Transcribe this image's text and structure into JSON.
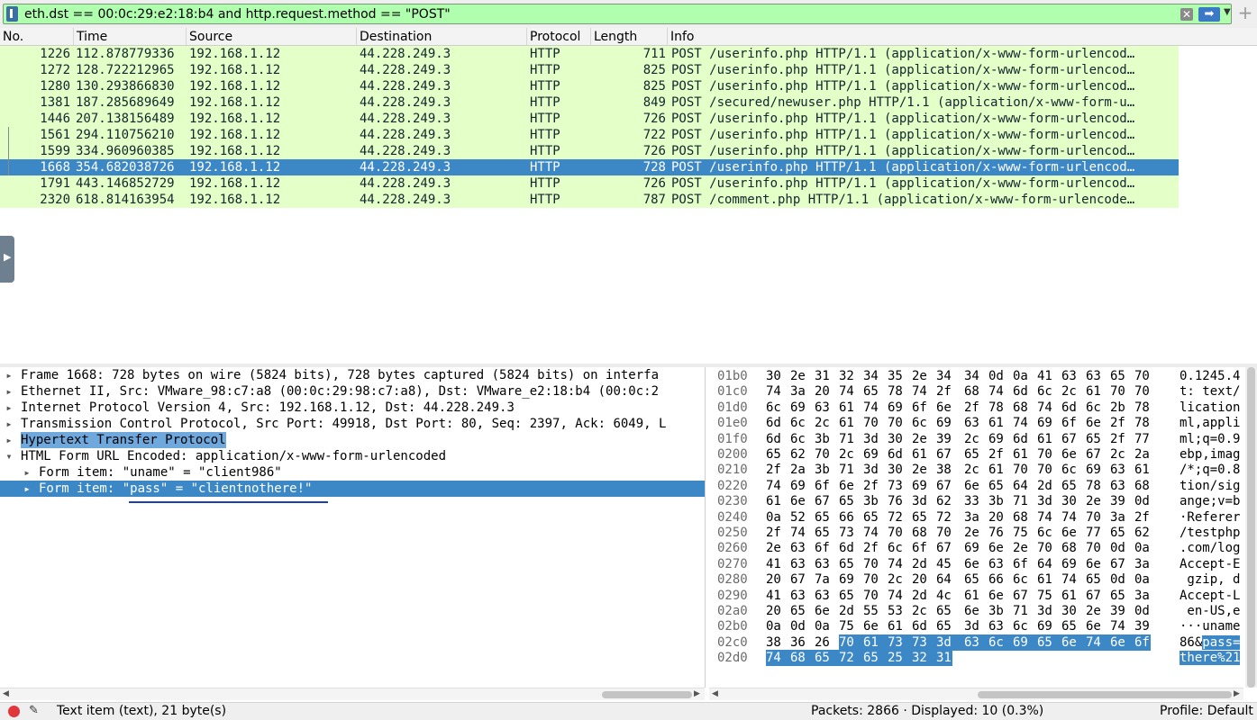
{
  "filter": {
    "value": "eth.dst == 00:0c:29:e2:18:b4 and http.request.method == \"POST\"",
    "clear_glyph": "✕",
    "apply_glyph": "➡",
    "dropdown_glyph": "▼",
    "add_glyph": "+"
  },
  "packet_list": {
    "columns": [
      "No.",
      "Time",
      "Source",
      "Destination",
      "Protocol",
      "Length",
      "Info"
    ],
    "rows": [
      {
        "no": "1226",
        "time": "112.878779336",
        "src": "192.168.1.12",
        "dst": "44.228.249.3",
        "proto": "HTTP",
        "len": "711",
        "info": "POST /userinfo.php HTTP/1.1  (application/x-www-form-urlencod…"
      },
      {
        "no": "1272",
        "time": "128.722212965",
        "src": "192.168.1.12",
        "dst": "44.228.249.3",
        "proto": "HTTP",
        "len": "825",
        "info": "POST /userinfo.php HTTP/1.1  (application/x-www-form-urlencod…"
      },
      {
        "no": "1280",
        "time": "130.293866830",
        "src": "192.168.1.12",
        "dst": "44.228.249.3",
        "proto": "HTTP",
        "len": "825",
        "info": "POST /userinfo.php HTTP/1.1  (application/x-www-form-urlencod…"
      },
      {
        "no": "1381",
        "time": "187.285689649",
        "src": "192.168.1.12",
        "dst": "44.228.249.3",
        "proto": "HTTP",
        "len": "849",
        "info": "POST /secured/newuser.php HTTP/1.1  (application/x-www-form-u…"
      },
      {
        "no": "1446",
        "time": "207.138156489",
        "src": "192.168.1.12",
        "dst": "44.228.249.3",
        "proto": "HTTP",
        "len": "726",
        "info": "POST /userinfo.php HTTP/1.1  (application/x-www-form-urlencod…"
      },
      {
        "no": "1561",
        "time": "294.110756210",
        "src": "192.168.1.12",
        "dst": "44.228.249.3",
        "proto": "HTTP",
        "len": "722",
        "info": "POST /userinfo.php HTTP/1.1  (application/x-www-form-urlencod…"
      },
      {
        "no": "1599",
        "time": "334.960960385",
        "src": "192.168.1.12",
        "dst": "44.228.249.3",
        "proto": "HTTP",
        "len": "726",
        "info": "POST /userinfo.php HTTP/1.1  (application/x-www-form-urlencod…"
      },
      {
        "no": "1668",
        "time": "354.682038726",
        "src": "192.168.1.12",
        "dst": "44.228.249.3",
        "proto": "HTTP",
        "len": "728",
        "info": "POST /userinfo.php HTTP/1.1  (application/x-www-form-urlencod…"
      },
      {
        "no": "1791",
        "time": "443.146852729",
        "src": "192.168.1.12",
        "dst": "44.228.249.3",
        "proto": "HTTP",
        "len": "726",
        "info": "POST /userinfo.php HTTP/1.1  (application/x-www-form-urlencod…"
      },
      {
        "no": "2320",
        "time": "618.814163954",
        "src": "192.168.1.12",
        "dst": "44.228.249.3",
        "proto": "HTTP",
        "len": "787",
        "info": "POST /comment.php HTTP/1.1  (application/x-www-form-urlencode…"
      }
    ],
    "selected_no": "1668"
  },
  "details": {
    "rows": [
      {
        "text": "Frame 1668: 728 bytes on wire (5824 bits), 728 bytes captured (5824 bits) on interfa",
        "indent": 0,
        "state": "collapsed"
      },
      {
        "text": "Ethernet II, Src: VMware_98:c7:a8 (00:0c:29:98:c7:a8), Dst: VMware_e2:18:b4 (00:0c:2",
        "indent": 0,
        "state": "collapsed"
      },
      {
        "text": "Internet Protocol Version 4, Src: 192.168.1.12, Dst: 44.228.249.3",
        "indent": 0,
        "state": "collapsed"
      },
      {
        "text": "Transmission Control Protocol, Src Port: 49918, Dst Port: 80, Seq: 2397, Ack: 6049, L",
        "indent": 0,
        "state": "collapsed"
      },
      {
        "text": "Hypertext Transfer Protocol",
        "indent": 0,
        "state": "collapsed"
      },
      {
        "text": "HTML Form URL Encoded: application/x-www-form-urlencoded",
        "indent": 0,
        "state": "expanded"
      },
      {
        "text": "Form item: \"uname\" = \"client986\"",
        "indent": 1,
        "state": "collapsed"
      },
      {
        "text": "Form item: \"pass\" = \"clientnothere!\"",
        "indent": 1,
        "state": "collapsed"
      }
    ]
  },
  "hex": {
    "rows": [
      {
        "off": "01b0",
        "bytes": [
          "30",
          "2e",
          "31",
          "32",
          "34",
          "35",
          "2e",
          "34",
          "34",
          "0d",
          "0a",
          "41",
          "63",
          "63",
          "65",
          "70"
        ],
        "ascii": "0.1245.4",
        "sel_start": -1,
        "sel_end": -1
      },
      {
        "off": "01c0",
        "bytes": [
          "74",
          "3a",
          "20",
          "74",
          "65",
          "78",
          "74",
          "2f",
          "68",
          "74",
          "6d",
          "6c",
          "2c",
          "61",
          "70",
          "70"
        ],
        "ascii": "t: text/",
        "sel_start": -1,
        "sel_end": -1
      },
      {
        "off": "01d0",
        "bytes": [
          "6c",
          "69",
          "63",
          "61",
          "74",
          "69",
          "6f",
          "6e",
          "2f",
          "78",
          "68",
          "74",
          "6d",
          "6c",
          "2b",
          "78"
        ],
        "ascii": "lication",
        "sel_start": -1,
        "sel_end": -1
      },
      {
        "off": "01e0",
        "bytes": [
          "6d",
          "6c",
          "2c",
          "61",
          "70",
          "70",
          "6c",
          "69",
          "63",
          "61",
          "74",
          "69",
          "6f",
          "6e",
          "2f",
          "78"
        ],
        "ascii": "ml,appli",
        "sel_start": -1,
        "sel_end": -1
      },
      {
        "off": "01f0",
        "bytes": [
          "6d",
          "6c",
          "3b",
          "71",
          "3d",
          "30",
          "2e",
          "39",
          "2c",
          "69",
          "6d",
          "61",
          "67",
          "65",
          "2f",
          "77"
        ],
        "ascii": "ml;q=0.9",
        "sel_start": -1,
        "sel_end": -1
      },
      {
        "off": "0200",
        "bytes": [
          "65",
          "62",
          "70",
          "2c",
          "69",
          "6d",
          "61",
          "67",
          "65",
          "2f",
          "61",
          "70",
          "6e",
          "67",
          "2c",
          "2a"
        ],
        "ascii": "ebp,imag",
        "sel_start": -1,
        "sel_end": -1
      },
      {
        "off": "0210",
        "bytes": [
          "2f",
          "2a",
          "3b",
          "71",
          "3d",
          "30",
          "2e",
          "38",
          "2c",
          "61",
          "70",
          "70",
          "6c",
          "69",
          "63",
          "61"
        ],
        "ascii": "/*;q=0.8",
        "sel_start": -1,
        "sel_end": -1
      },
      {
        "off": "0220",
        "bytes": [
          "74",
          "69",
          "6f",
          "6e",
          "2f",
          "73",
          "69",
          "67",
          "6e",
          "65",
          "64",
          "2d",
          "65",
          "78",
          "63",
          "68"
        ],
        "ascii": "tion/sig",
        "sel_start": -1,
        "sel_end": -1
      },
      {
        "off": "0230",
        "bytes": [
          "61",
          "6e",
          "67",
          "65",
          "3b",
          "76",
          "3d",
          "62",
          "33",
          "3b",
          "71",
          "3d",
          "30",
          "2e",
          "39",
          "0d"
        ],
        "ascii": "ange;v=b",
        "sel_start": -1,
        "sel_end": -1
      },
      {
        "off": "0240",
        "bytes": [
          "0a",
          "52",
          "65",
          "66",
          "65",
          "72",
          "65",
          "72",
          "3a",
          "20",
          "68",
          "74",
          "74",
          "70",
          "3a",
          "2f"
        ],
        "ascii": "·Referer",
        "sel_start": -1,
        "sel_end": -1
      },
      {
        "off": "0250",
        "bytes": [
          "2f",
          "74",
          "65",
          "73",
          "74",
          "70",
          "68",
          "70",
          "2e",
          "76",
          "75",
          "6c",
          "6e",
          "77",
          "65",
          "62"
        ],
        "ascii": "/testphp",
        "sel_start": -1,
        "sel_end": -1
      },
      {
        "off": "0260",
        "bytes": [
          "2e",
          "63",
          "6f",
          "6d",
          "2f",
          "6c",
          "6f",
          "67",
          "69",
          "6e",
          "2e",
          "70",
          "68",
          "70",
          "0d",
          "0a"
        ],
        "ascii": ".com/log",
        "sel_start": -1,
        "sel_end": -1
      },
      {
        "off": "0270",
        "bytes": [
          "41",
          "63",
          "63",
          "65",
          "70",
          "74",
          "2d",
          "45",
          "6e",
          "63",
          "6f",
          "64",
          "69",
          "6e",
          "67",
          "3a"
        ],
        "ascii": "Accept-E",
        "sel_start": -1,
        "sel_end": -1
      },
      {
        "off": "0280",
        "bytes": [
          "20",
          "67",
          "7a",
          "69",
          "70",
          "2c",
          "20",
          "64",
          "65",
          "66",
          "6c",
          "61",
          "74",
          "65",
          "0d",
          "0a"
        ],
        "ascii": " gzip, d",
        "sel_start": -1,
        "sel_end": -1
      },
      {
        "off": "0290",
        "bytes": [
          "41",
          "63",
          "63",
          "65",
          "70",
          "74",
          "2d",
          "4c",
          "61",
          "6e",
          "67",
          "75",
          "61",
          "67",
          "65",
          "3a"
        ],
        "ascii": "Accept-L",
        "sel_start": -1,
        "sel_end": -1
      },
      {
        "off": "02a0",
        "bytes": [
          "20",
          "65",
          "6e",
          "2d",
          "55",
          "53",
          "2c",
          "65",
          "6e",
          "3b",
          "71",
          "3d",
          "30",
          "2e",
          "39",
          "0d"
        ],
        "ascii": " en-US,e",
        "sel_start": -1,
        "sel_end": -1
      },
      {
        "off": "02b0",
        "bytes": [
          "0a",
          "0d",
          "0a",
          "75",
          "6e",
          "61",
          "6d",
          "65",
          "3d",
          "63",
          "6c",
          "69",
          "65",
          "6e",
          "74",
          "39"
        ],
        "ascii": "···uname",
        "sel_start": -1,
        "sel_end": -1
      },
      {
        "off": "02c0",
        "bytes": [
          "38",
          "36",
          "26",
          "70",
          "61",
          "73",
          "73",
          "3d",
          "63",
          "6c",
          "69",
          "65",
          "6e",
          "74",
          "6e",
          "6f"
        ],
        "ascii": "86&pass=",
        "sel_start": 3,
        "sel_end": 15
      },
      {
        "off": "02d0",
        "bytes": [
          "74",
          "68",
          "65",
          "72",
          "65",
          "25",
          "32",
          "31"
        ],
        "ascii": "there%21",
        "sel_start": 0,
        "sel_end": 7
      }
    ]
  },
  "status": {
    "text": "Text item (text), 21 byte(s)",
    "packets": "Packets: 2866 · Displayed: 10 (0.3%)",
    "profile": "Profile: Default"
  },
  "colors": {
    "row_bg": "#e4ffc7",
    "selected_bg": "#3c87c6",
    "filter_bg": "#afffaf"
  }
}
